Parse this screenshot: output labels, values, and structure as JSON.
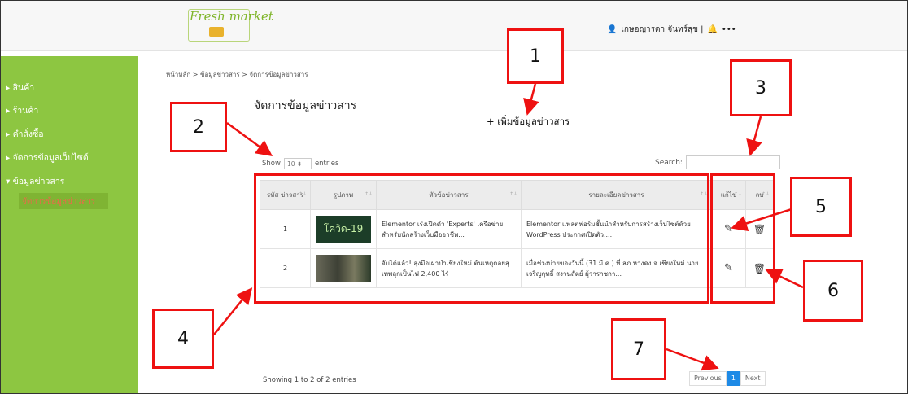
{
  "header": {
    "logo_text": "Fresh market",
    "user_name": "เกษอญารดา จันทร์สุข |",
    "user_icon": "user-icon",
    "bell_icon": "bell-icon",
    "more_label": "•••"
  },
  "sidebar": {
    "items": [
      {
        "label": "▸ สินค้า"
      },
      {
        "label": "▸ ร้านค้า"
      },
      {
        "label": "▸ คำสั่งซื้อ"
      },
      {
        "label": "▸ จัดการข้อมูลเว็บไซต์"
      },
      {
        "label": "▾ ข้อมูลข่าวสาร"
      }
    ],
    "sub_item": "จัดการข้อมูลข่าวสาร"
  },
  "breadcrumb": "หน้าหลัก > ข้อมูลข่าวสาร > จัดการข้อมูลข่าวสาร",
  "page_title": "จัดการข้อมูลข่าวสาร",
  "add_button": "+ เพิ่มข้อมูลข่าวสาร",
  "table_controls": {
    "show_label": "Show",
    "show_value": "10 ⬍",
    "entries_label": "entries",
    "search_label": "Search:"
  },
  "table": {
    "headers": [
      "รหัส ข่าวสาร",
      "รูปภาพ",
      "หัวข้อข่าวสาร",
      "รายละเอียดข่าวสาร",
      "แก้ไข",
      "ลบ"
    ],
    "rows": [
      {
        "id": "1",
        "thumb_text": "โควิด-19",
        "title": "Elementor เร่งเปิดตัว 'Experts' เครือข่ายสำหรับนักสร้างเว็บมืออาชีพ...",
        "detail": "Elementor แพลตฟอร์มชั้นนำสำหรับการสร้างเว็บไซต์ด้วย WordPress ประกาศเปิดตัว...."
      },
      {
        "id": "2",
        "thumb_text": "",
        "title": "จับได้แล้ว! ลุงมือเผาป่าเชียงใหม่ ต้นเหตุดอยสุเทพลุกเป็นไฟ 2,400 ไร่",
        "detail": "เมื่อช่วงบ่ายของวันนี้ (31 มี.ค.) ที่ สภ.หางดง จ.เชียงใหม่ นายเจริญฤทธิ์ สงวนสัตย์ ผู้ว่าราชกา..."
      }
    ]
  },
  "footer": {
    "showing": "Showing 1 to 2 of 2 entries",
    "previous": "Previous",
    "page": "1",
    "next": "Next"
  },
  "callouts": [
    "1",
    "2",
    "3",
    "4",
    "5",
    "6",
    "7"
  ],
  "colors": {
    "sidebar": "#8dc641",
    "callout": "#e11111",
    "active_page": "#1e8ae6"
  }
}
